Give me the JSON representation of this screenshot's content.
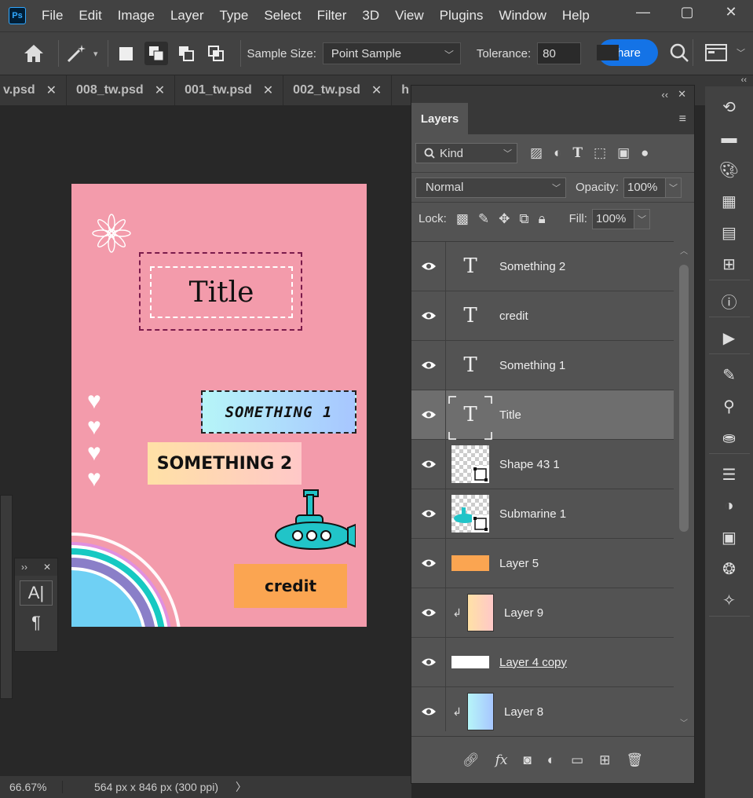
{
  "app": {
    "logo": "Ps"
  },
  "menu": [
    "File",
    "Edit",
    "Image",
    "Layer",
    "Type",
    "Select",
    "Filter",
    "3D",
    "View",
    "Plugins",
    "Window",
    "Help"
  ],
  "window_controls": {
    "minimize": "—",
    "maximize": "▢",
    "close": "✕"
  },
  "options": {
    "sample_size_label": "Sample Size:",
    "sample_size_value": "Point Sample",
    "tolerance_label": "Tolerance:",
    "tolerance_value": "80",
    "share_label": "hare"
  },
  "tabs": [
    {
      "label": "v.psd"
    },
    {
      "label": "008_tw.psd"
    },
    {
      "label": "001_tw.psd"
    },
    {
      "label": "002_tw.psd"
    },
    {
      "label": "h"
    }
  ],
  "document": {
    "title_text": "Title",
    "something1_text": "SOMETHING 1",
    "something2_text": "SOMETHING 2",
    "credit_text": "credit",
    "hearts": "♥\n♥\n♥\n♥"
  },
  "colors": {
    "canvas_bg": "#f39bab",
    "accent": "#1473e6",
    "credit_bg": "#fba551",
    "title_border": "#7a1b4b"
  },
  "status": {
    "zoom": "66.67%",
    "dimensions": "564 px x 846 px (300 ppi)"
  },
  "char_panel": {
    "type_btn": "A|",
    "para_btn": "¶"
  },
  "layers_panel": {
    "tab": "Layers",
    "kind_label": "Kind",
    "blend_mode": "Normal",
    "opacity_label": "Opacity:",
    "opacity_value": "100%",
    "lock_label": "Lock:",
    "fill_label": "Fill:",
    "fill_value": "100%",
    "layers": [
      {
        "name": "Something 2",
        "thumb": "type"
      },
      {
        "name": "credit",
        "thumb": "type"
      },
      {
        "name": "Something 1",
        "thumb": "type"
      },
      {
        "name": "Title",
        "thumb": "type",
        "selected": true
      },
      {
        "name": "Shape 43 1",
        "thumb": "smart"
      },
      {
        "name": "Submarine 1",
        "thumb": "smart-sub"
      },
      {
        "name": "Layer 5",
        "thumb": "orange"
      },
      {
        "name": "Layer 9",
        "thumb": "peach",
        "clipped": true
      },
      {
        "name": "Layer 4 copy",
        "thumb": "white",
        "underline": true
      },
      {
        "name": "Layer 8",
        "thumb": "blue",
        "clipped": true
      }
    ]
  }
}
